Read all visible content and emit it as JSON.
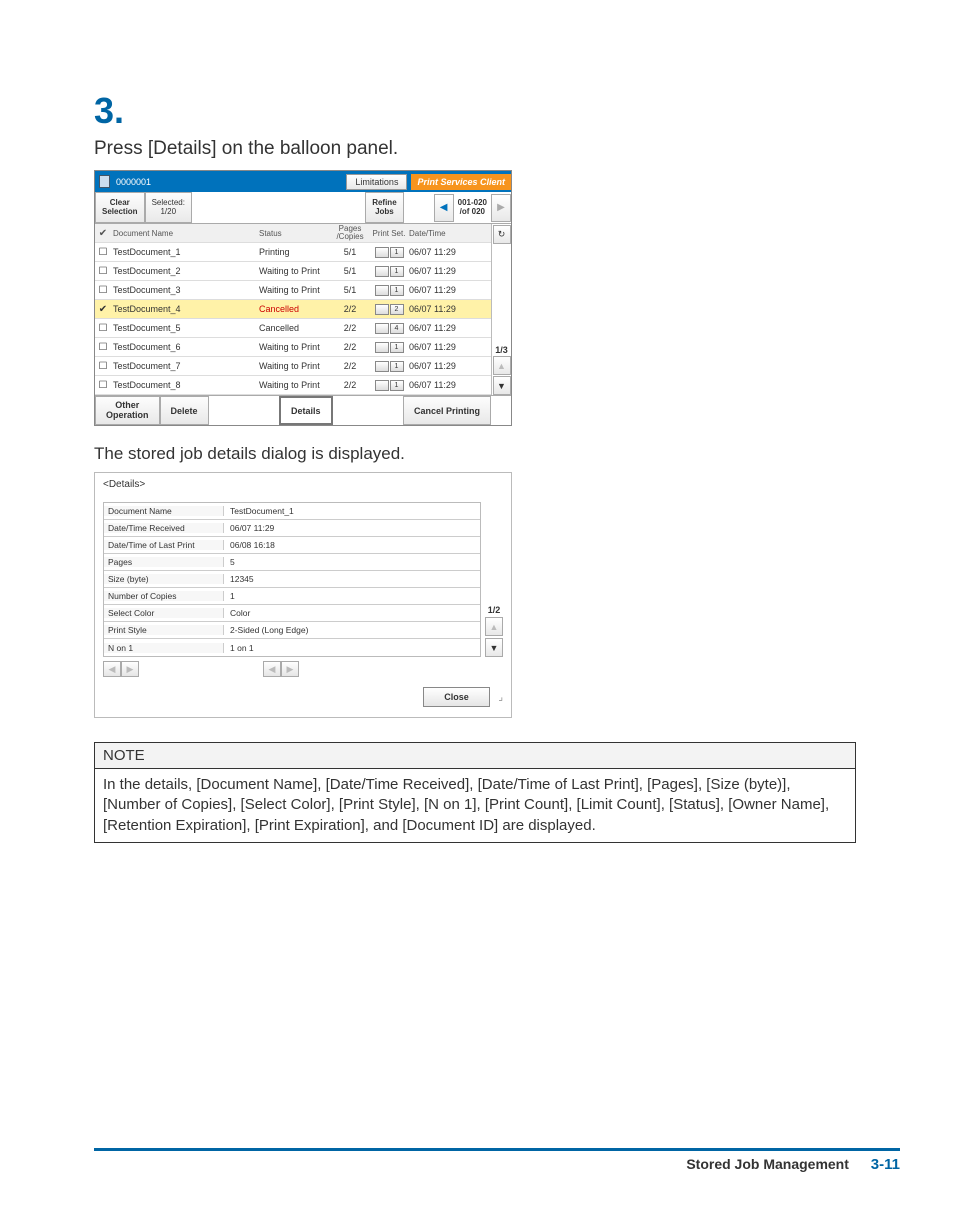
{
  "step": {
    "num": "3.",
    "text": "Press [Details] on the balloon panel."
  },
  "ss1": {
    "title_id": "0000001",
    "limitations": "Limitations",
    "psc": "Print Services Client",
    "clear1": "Clear",
    "clear2": "Selection",
    "sel1": "Selected:",
    "sel2": "1/20",
    "refine1": "Refine",
    "refine2": "Jobs",
    "range1": "001-020",
    "range2": "/of 020",
    "hdr": {
      "name": "Document Name",
      "status": "Status",
      "pages": "Pages\n/Copies",
      "pset": "Print Set.",
      "date": "Date/Time"
    },
    "rows": [
      {
        "chk": "☐",
        "name": "TestDocument_1",
        "status": "Printing",
        "pc": "5/1",
        "ps2": "1",
        "dt": "06/07 11:29",
        "sel": false
      },
      {
        "chk": "☐",
        "name": "TestDocument_2",
        "status": "Waiting to Print",
        "pc": "5/1",
        "ps2": "1",
        "dt": "06/07 11:29",
        "sel": false
      },
      {
        "chk": "☐",
        "name": "TestDocument_3",
        "status": "Waiting to Print",
        "pc": "5/1",
        "ps2": "1",
        "dt": "06/07 11:29",
        "sel": false
      },
      {
        "chk": "✔",
        "name": "TestDocument_4",
        "status": "Cancelled",
        "pc": "2/2",
        "ps2": "2",
        "dt": "06/07 11:29",
        "sel": true
      },
      {
        "chk": "☐",
        "name": "TestDocument_5",
        "status": "Cancelled",
        "pc": "2/2",
        "ps2": "4",
        "dt": "06/07 11:29",
        "sel": false
      },
      {
        "chk": "☐",
        "name": "TestDocument_6",
        "status": "Waiting to Print",
        "pc": "2/2",
        "ps2": "1",
        "dt": "06/07 11:29",
        "sel": false
      },
      {
        "chk": "☐",
        "name": "TestDocument_7",
        "status": "Waiting to Print",
        "pc": "2/2",
        "ps2": "1",
        "dt": "06/07 11:29",
        "sel": false
      },
      {
        "chk": "☐",
        "name": "TestDocument_8",
        "status": "Waiting to Print",
        "pc": "2/2",
        "ps2": "1",
        "dt": "06/07 11:29",
        "sel": false
      }
    ],
    "side_page": "1/3",
    "foot": {
      "other1": "Other",
      "other2": "Operation",
      "delete": "Delete",
      "details": "Details",
      "cancel": "Cancel Printing"
    }
  },
  "caption": "The stored job details dialog is displayed.",
  "ss2": {
    "title": "<Details>",
    "rows": [
      {
        "lab": "Document Name",
        "val": "TestDocument_1"
      },
      {
        "lab": "Date/Time Received",
        "val": "06/07 11:29"
      },
      {
        "lab": "Date/Time of Last Print",
        "val": "06/08 16:18"
      },
      {
        "lab": "Pages",
        "val": "5"
      },
      {
        "lab": "Size (byte)",
        "val": "12345"
      },
      {
        "lab": "Number of Copies",
        "val": "1"
      },
      {
        "lab": "Select Color",
        "val": "Color"
      },
      {
        "lab": "Print Style",
        "val": "2-Sided (Long Edge)"
      },
      {
        "lab": "N on 1",
        "val": "1 on 1"
      }
    ],
    "side_page": "1/2",
    "close": "Close"
  },
  "note": {
    "head": "NOTE",
    "body": "In the details, [Document Name], [Date/Time Received], [Date/Time of Last Print], [Pages], [Size (byte)], [Number of Copies], [Select Color], [Print Style], [N on 1], [Print Count], [Limit Count], [Status], [Owner Name], [Retention Expiration], [Print Expiration], and [Document ID] are displayed."
  },
  "footer": {
    "section": "Stored Job Management",
    "page": "3-11"
  }
}
